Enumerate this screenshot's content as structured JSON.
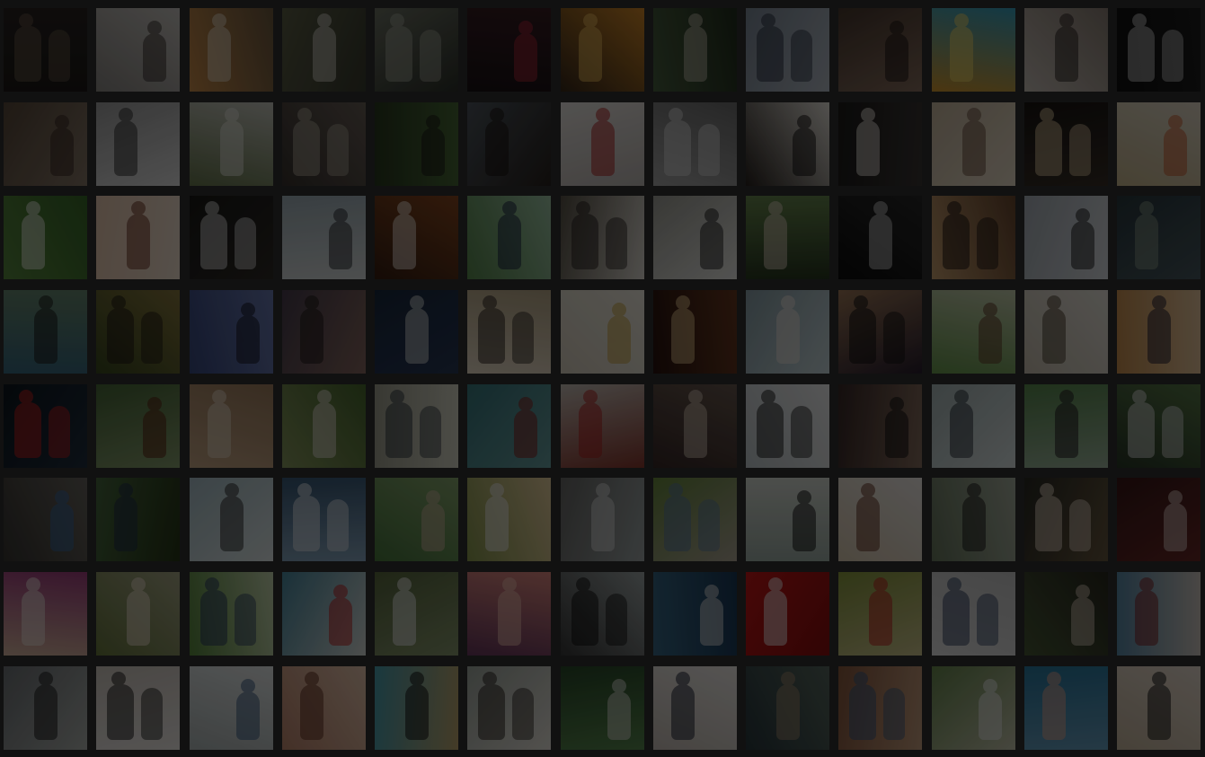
{
  "gallery": {
    "columns": 13,
    "rows": 8,
    "tiles": [
      {
        "bg": [
          "#1d1a18",
          "#2b2522"
        ],
        "fg": "#6a5a4c"
      },
      {
        "bg": [
          "#8d8a86",
          "#c9c5c0"
        ],
        "fg": "#3a3330"
      },
      {
        "bg": [
          "#c98c4a",
          "#6e5a42"
        ],
        "fg": "#e8dcc8"
      },
      {
        "bg": [
          "#5e6048",
          "#3a3d30"
        ],
        "fg": "#d9d6cc"
      },
      {
        "bg": [
          "#6f7466",
          "#2f332c"
        ],
        "fg": "#a4a89a"
      },
      {
        "bg": [
          "#1a1416",
          "#3a1e24"
        ],
        "fg": "#b0283a"
      },
      {
        "bg": [
          "#3a2a1a",
          "#d48a2a"
        ],
        "fg": "#f0c060"
      },
      {
        "bg": [
          "#4a6040",
          "#23301f"
        ],
        "fg": "#c6c0b0"
      },
      {
        "bg": [
          "#7e8a98",
          "#b4bcc6"
        ],
        "fg": "#2a3040"
      },
      {
        "bg": [
          "#4a3a30",
          "#8a7060"
        ],
        "fg": "#1e1614"
      },
      {
        "bg": [
          "#d49a30",
          "#3aa0c0"
        ],
        "fg": "#f6e06a"
      },
      {
        "bg": [
          "#c8c0b8",
          "#8c8076"
        ],
        "fg": "#2a2422"
      },
      {
        "bg": [
          "#121212",
          "#1e1e1e"
        ],
        "fg": "#d0d0d0"
      },
      {
        "bg": [
          "#5a4a3c",
          "#8a7a6a"
        ],
        "fg": "#3a2a22"
      },
      {
        "bg": [
          "#a0a0a0",
          "#e0e0e0"
        ],
        "fg": "#303030"
      },
      {
        "bg": [
          "#6a7a50",
          "#c8c8c0"
        ],
        "fg": "#e8e8e0"
      },
      {
        "bg": [
          "#3a3430",
          "#6a6058"
        ],
        "fg": "#b0a898"
      },
      {
        "bg": [
          "#2a3a20",
          "#4a6a38"
        ],
        "fg": "#1a1a18"
      },
      {
        "bg": [
          "#505860",
          "#2a2420"
        ],
        "fg": "#1a1412"
      },
      {
        "bg": [
          "#e8e4e0",
          "#c0bab6"
        ],
        "fg": "#b02020"
      },
      {
        "bg": [
          "#a8a8a8",
          "#707070"
        ],
        "fg": "#dcdcdc"
      },
      {
        "bg": [
          "#2a2420",
          "#e8e4dc"
        ],
        "fg": "#141212"
      },
      {
        "bg": [
          "#1e1c1a",
          "#3c3836"
        ],
        "fg": "#f0e8e0"
      },
      {
        "bg": [
          "#c8b8a0",
          "#e8dcc8"
        ],
        "fg": "#6a5040"
      },
      {
        "bg": [
          "#1a1614",
          "#3a3028"
        ],
        "fg": "#e0c8a0"
      },
      {
        "bg": [
          "#c8b890",
          "#e0d8c8"
        ],
        "fg": "#c85a30"
      },
      {
        "bg": [
          "#5a8a40",
          "#3a6a2a"
        ],
        "fg": "#f0f0e8"
      },
      {
        "bg": [
          "#e8c8b0",
          "#f0e0d0"
        ],
        "fg": "#6a3020"
      },
      {
        "bg": [
          "#1a1a18",
          "#302c28"
        ],
        "fg": "#e0e0e0"
      },
      {
        "bg": [
          "#a0b0b8",
          "#d8dcdc"
        ],
        "fg": "#2a2a30"
      },
      {
        "bg": [
          "#3a2014",
          "#8a4a20"
        ],
        "fg": "#f0e8e0"
      },
      {
        "bg": [
          "#5a8a50",
          "#a0c8a8"
        ],
        "fg": "#1a2040"
      },
      {
        "bg": [
          "#5a5448",
          "#e0dcd4"
        ],
        "fg": "#2a2422"
      },
      {
        "bg": [
          "#a0a098",
          "#e8e8e4"
        ],
        "fg": "#202020"
      },
      {
        "bg": [
          "#6a8a50",
          "#283820"
        ],
        "fg": "#e0d0c0"
      },
      {
        "bg": [
          "#0e0e0e",
          "#2a2a2a"
        ],
        "fg": "#d0d0d0"
      },
      {
        "bg": [
          "#c8a070",
          "#6a4830"
        ],
        "fg": "#1a1210"
      },
      {
        "bg": [
          "#a8b0b8",
          "#d8dce0"
        ],
        "fg": "#1a1a1a"
      },
      {
        "bg": [
          "#2a3a40",
          "#4a5a60"
        ],
        "fg": "#8a9a88"
      },
      {
        "bg": [
          "#3a6a80",
          "#6a8a70"
        ],
        "fg": "#1a1a1a"
      },
      {
        "bg": [
          "#3a4a20",
          "#8a7a40"
        ],
        "fg": "#201a14"
      },
      {
        "bg": [
          "#3a4a80",
          "#6a7ab0"
        ],
        "fg": "#141420"
      },
      {
        "bg": [
          "#4a4050",
          "#8a6a60"
        ],
        "fg": "#201a1a"
      },
      {
        "bg": [
          "#1a2a40",
          "#2a3a58"
        ],
        "fg": "#d8d8d8"
      },
      {
        "bg": [
          "#e8dcc8",
          "#b8a888"
        ],
        "fg": "#2a2420"
      },
      {
        "bg": [
          "#d8d0c0",
          "#f0ece0"
        ],
        "fg": "#c8a040"
      },
      {
        "bg": [
          "#2a1410",
          "#6a3a20"
        ],
        "fg": "#e8c890"
      },
      {
        "bg": [
          "#8aa0a8",
          "#c8d8dc"
        ],
        "fg": "#f0e8e0"
      },
      {
        "bg": [
          "#a07a5a",
          "#2a2030"
        ],
        "fg": "#101010"
      },
      {
        "bg": [
          "#6a9a50",
          "#c8d0b0"
        ],
        "fg": "#603a28"
      },
      {
        "bg": [
          "#c8c0b0",
          "#e8e4dc"
        ],
        "fg": "#4a4030"
      },
      {
        "bg": [
          "#c89050",
          "#e8c8a0"
        ],
        "fg": "#1a1a30"
      },
      {
        "bg": [
          "#101820",
          "#203040"
        ],
        "fg": "#d02020"
      },
      {
        "bg": [
          "#4a6a3a",
          "#8aa070"
        ],
        "fg": "#5a2010"
      },
      {
        "bg": [
          "#c8a888",
          "#a08060"
        ],
        "fg": "#e8dcc8"
      },
      {
        "bg": [
          "#8a9a60",
          "#4a6a30"
        ],
        "fg": "#e8e0d8"
      },
      {
        "bg": [
          "#a0a090",
          "#d8d8c8"
        ],
        "fg": "#303840"
      },
      {
        "bg": [
          "#3a7a80",
          "#6aa0a0"
        ],
        "fg": "#8a1e1a"
      },
      {
        "bg": [
          "#c8c0b8",
          "#8a3a30"
        ],
        "fg": "#b02020"
      },
      {
        "bg": [
          "#3a2a28",
          "#6a5a50"
        ],
        "fg": "#d8c8b8"
      },
      {
        "bg": [
          "#c0c8cc",
          "#f0f0f0"
        ],
        "fg": "#1a1a1a"
      },
      {
        "bg": [
          "#3a2a28",
          "#8a7060"
        ],
        "fg": "#101010"
      },
      {
        "bg": [
          "#a8b8b8",
          "#dce4e4"
        ],
        "fg": "#283038"
      },
      {
        "bg": [
          "#5a8a50",
          "#a0b8a0"
        ],
        "fg": "#201820"
      },
      {
        "bg": [
          "#2a3a28",
          "#5a7a4a"
        ],
        "fg": "#e0e0e0"
      },
      {
        "bg": [
          "#3a3834",
          "#6a6660"
        ],
        "fg": "#3a6aa0"
      },
      {
        "bg": [
          "#4a6a40",
          "#283818"
        ],
        "fg": "#20304a"
      },
      {
        "bg": [
          "#a8c0c8",
          "#e0e8e8"
        ],
        "fg": "#2a2a2a"
      },
      {
        "bg": [
          "#3a5a78",
          "#8aa8c0"
        ],
        "fg": "#e8ecf0"
      },
      {
        "bg": [
          "#4a7a40",
          "#8aa870"
        ],
        "fg": "#d0b8a0"
      },
      {
        "bg": [
          "#8a9a50",
          "#e8d0a0"
        ],
        "fg": "#f0f0f0"
      },
      {
        "bg": [
          "#6a6a68",
          "#a0a8a8"
        ],
        "fg": "#e0e0e0"
      },
      {
        "bg": [
          "#6a8a40",
          "#b0a898"
        ],
        "fg": "#5a7aa0"
      },
      {
        "bg": [
          "#a0b0a8",
          "#d8dcd4"
        ],
        "fg": "#101010"
      },
      {
        "bg": [
          "#d8c8b0",
          "#f0ece8"
        ],
        "fg": "#603020"
      },
      {
        "bg": [
          "#6a7a60",
          "#a8b0a0"
        ],
        "fg": "#1a1a1a"
      },
      {
        "bg": [
          "#2a2a24",
          "#6a5a40"
        ],
        "fg": "#e8d8c8"
      },
      {
        "bg": [
          "#3a1818",
          "#6a2a28"
        ],
        "fg": "#e0d0c8"
      },
      {
        "bg": [
          "#d8b8a0",
          "#a04080"
        ],
        "fg": "#f0e8e0"
      },
      {
        "bg": [
          "#6a7a40",
          "#a8a888"
        ],
        "fg": "#f0e0d0"
      },
      {
        "bg": [
          "#5a8a40",
          "#c8d8b0"
        ],
        "fg": "#2a3a60"
      },
      {
        "bg": [
          "#4a8aa0",
          "#d8dcd8"
        ],
        "fg": "#c02020"
      },
      {
        "bg": [
          "#5a6a40",
          "#8a9a70"
        ],
        "fg": "#f0f0f0"
      },
      {
        "bg": [
          "#6a3a60",
          "#e08a80"
        ],
        "fg": "#f0c0b0"
      },
      {
        "bg": [
          "#3a3a3a",
          "#a0a8a8"
        ],
        "fg": "#101010"
      },
      {
        "bg": [
          "#3a6a88",
          "#1a3a58"
        ],
        "fg": "#e0e0e0"
      },
      {
        "bg": [
          "#c81818",
          "#8a1010"
        ],
        "fg": "#f0f0f0"
      },
      {
        "bg": [
          "#8a9a40",
          "#d0c890"
        ],
        "fg": "#c02020"
      },
      {
        "bg": [
          "#e0e0e0",
          "#c8c8c8"
        ],
        "fg": "#304060"
      },
      {
        "bg": [
          "#4a5a38",
          "#2a2a20"
        ],
        "fg": "#d8c8b8"
      },
      {
        "bg": [
          "#5a8aa8",
          "#d0c8c0"
        ],
        "fg": "#802020"
      },
      {
        "bg": [
          "#707478",
          "#b0b4b0"
        ],
        "fg": "#1a1a1a"
      },
      {
        "bg": [
          "#d0c8c0",
          "#f0ece8"
        ],
        "fg": "#1a1a1a"
      },
      {
        "bg": [
          "#b0b8b8",
          "#e8ecec"
        ],
        "fg": "#3a5a80"
      },
      {
        "bg": [
          "#c08870",
          "#e8c8b0"
        ],
        "fg": "#603020"
      },
      {
        "bg": [
          "#4aa0b0",
          "#c0a870"
        ],
        "fg": "#101010"
      },
      {
        "bg": [
          "#a0a8a0",
          "#e8e4dc"
        ],
        "fg": "#2a2420"
      },
      {
        "bg": [
          "#2a4a2a",
          "#5a8a50"
        ],
        "fg": "#e0e0d8"
      },
      {
        "bg": [
          "#c8c0b8",
          "#f0ece8"
        ],
        "fg": "#1a2030"
      },
      {
        "bg": [
          "#2a3a40",
          "#5a6a60"
        ],
        "fg": "#a08a70"
      },
      {
        "bg": [
          "#8a5a40",
          "#c8a080"
        ],
        "fg": "#3a5a80"
      },
      {
        "bg": [
          "#6a8a50",
          "#c8c8b0"
        ],
        "fg": "#f0f0f0"
      },
      {
        "bg": [
          "#2a7aa0",
          "#6aa0c0"
        ],
        "fg": "#e8a890"
      },
      {
        "bg": [
          "#c8b8a0",
          "#e8dcd0"
        ],
        "fg": "#101010"
      }
    ]
  }
}
